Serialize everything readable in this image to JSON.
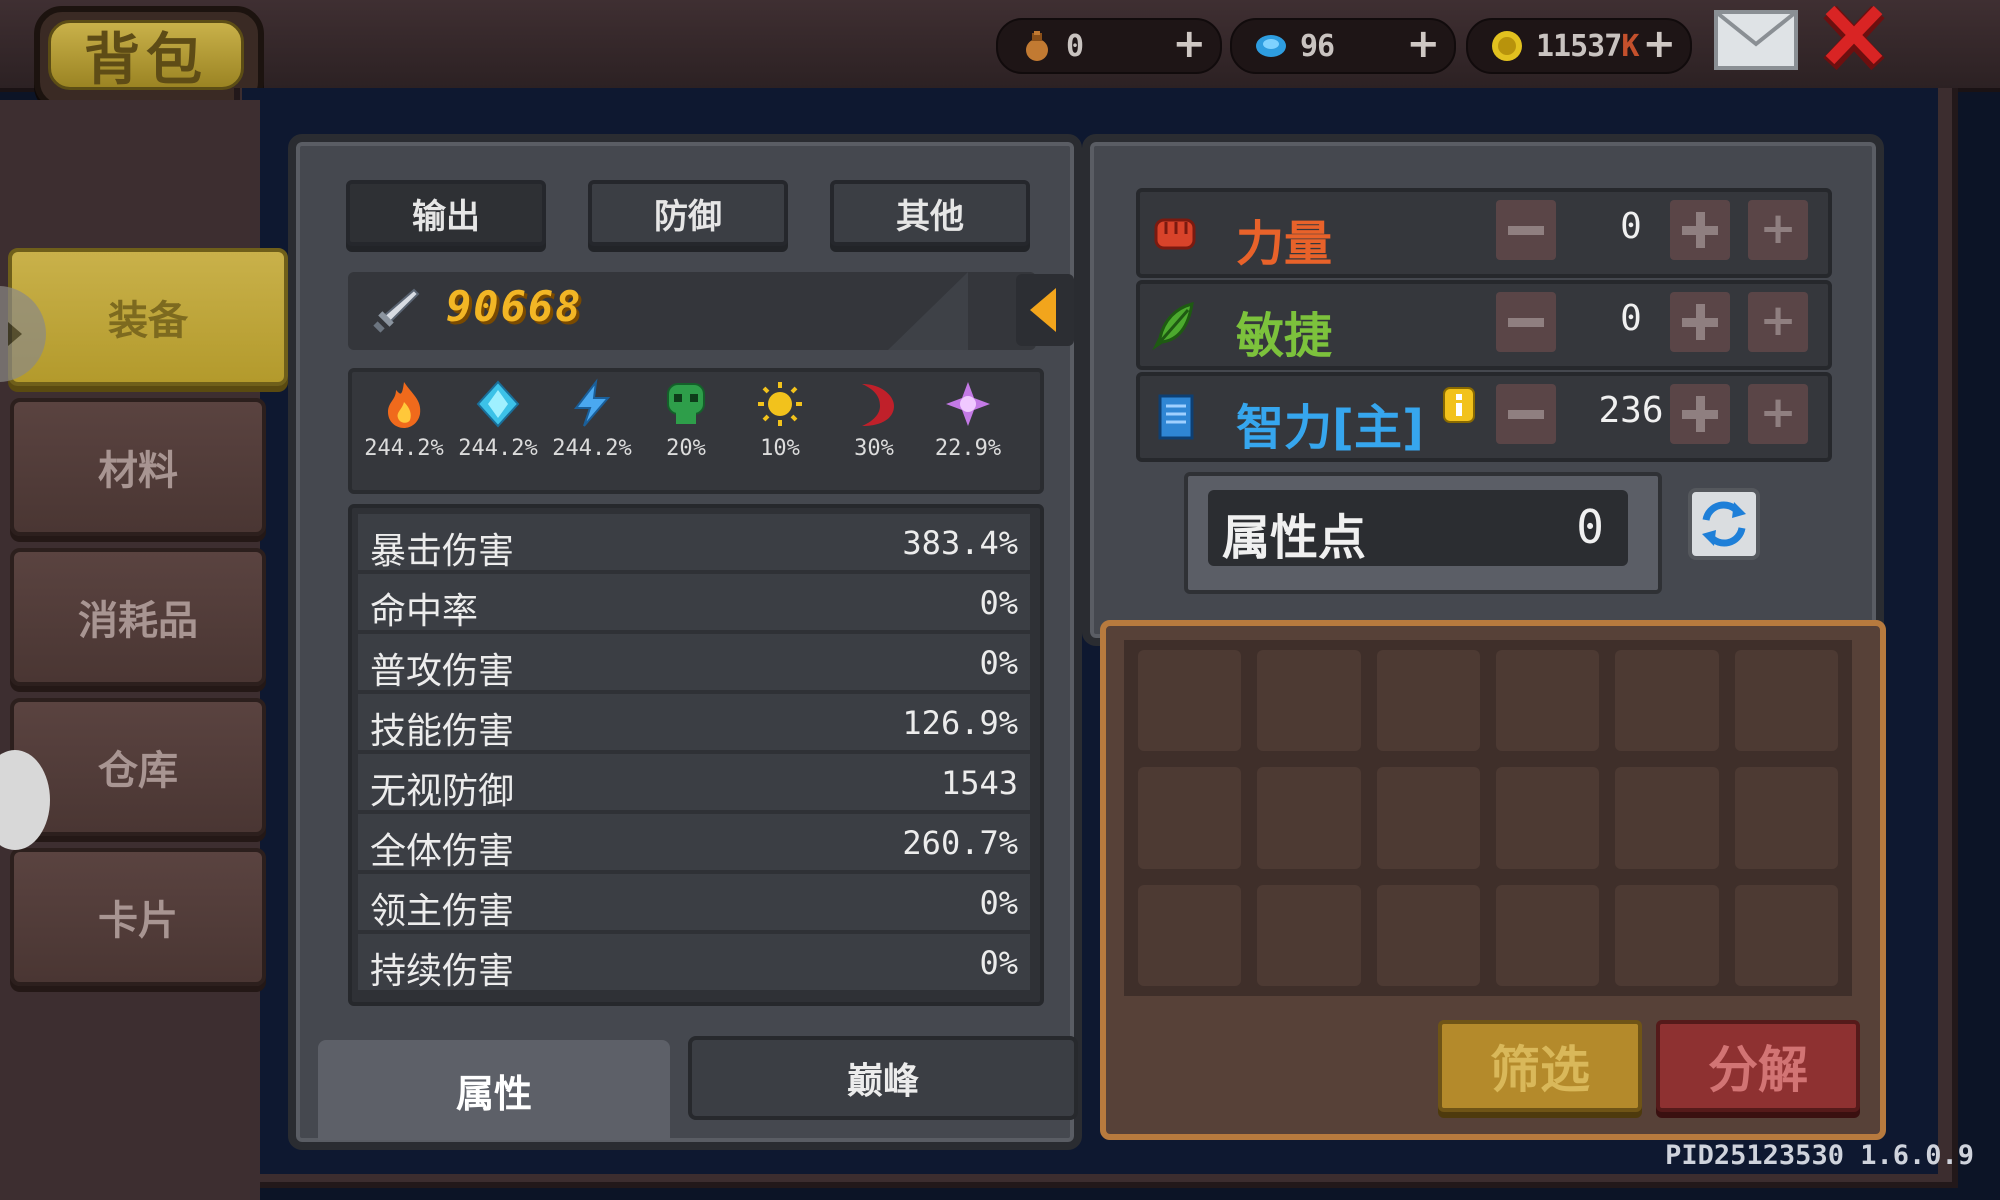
{
  "header": {
    "title": "背包",
    "currencies": [
      {
        "icon": "bag-icon",
        "value": "0",
        "suffix": "",
        "color": "#c27a32"
      },
      {
        "icon": "gem-icon",
        "value": "96",
        "suffix": "",
        "color": "#2e9de0"
      },
      {
        "icon": "gold-coin-icon",
        "value": "11537",
        "suffix": "K",
        "color": "#e2c11f"
      }
    ],
    "mail_icon": "envelope-icon",
    "close_icon": "close-x-icon"
  },
  "nav": {
    "items": [
      {
        "label": "装备",
        "active": true
      },
      {
        "label": "材料",
        "active": false
      },
      {
        "label": "消耗品",
        "active": false
      },
      {
        "label": "仓库",
        "active": false
      },
      {
        "label": "卡片",
        "active": false
      }
    ]
  },
  "stats": {
    "tabs": [
      "输出",
      "防御",
      "其他"
    ],
    "active_tab": "输出",
    "power_icon": "sword-icon",
    "power": "90668",
    "elements": [
      {
        "icon": "fire-icon",
        "value": "244.2%",
        "color": "#f06a1c"
      },
      {
        "icon": "ice-crystal-icon",
        "value": "244.2%",
        "color": "#3cc2e8"
      },
      {
        "icon": "lightning-icon",
        "value": "244.2%",
        "color": "#4aa8f0"
      },
      {
        "icon": "poison-skull-icon",
        "value": "20%",
        "color": "#2e9e4a"
      },
      {
        "icon": "sun-icon",
        "value": "10%",
        "color": "#f2c21c"
      },
      {
        "icon": "crescent-moon-icon",
        "value": "30%",
        "color": "#c0202a"
      },
      {
        "icon": "arcane-star-icon",
        "value": "22.9%",
        "color": "#c47ae6"
      }
    ],
    "rows": [
      {
        "label": "暴击伤害",
        "value": "383.4%"
      },
      {
        "label": "命中率",
        "value": "0%"
      },
      {
        "label": "普攻伤害",
        "value": "0%"
      },
      {
        "label": "技能伤害",
        "value": "126.9%"
      },
      {
        "label": "无视防御",
        "value": "1543"
      },
      {
        "label": "全体伤害",
        "value": "260.7%"
      },
      {
        "label": "领主伤害",
        "value": "0%"
      },
      {
        "label": "持续伤害",
        "value": "0%"
      }
    ],
    "bottom_tabs": [
      "属性",
      "巅峰"
    ]
  },
  "attributes": {
    "rows": [
      {
        "icon": "fist-icon",
        "name": "力量",
        "value": "0",
        "color": "#e8622a"
      },
      {
        "icon": "feather-icon",
        "name": "敏捷",
        "value": "0",
        "color": "#7cc23c"
      },
      {
        "icon": "book-icon",
        "name": "智力[主]",
        "value": "236",
        "color": "#36a6ee"
      }
    ],
    "points_label": "属性点",
    "points_value": "0",
    "reset_icon": "refresh-icon"
  },
  "inventory": {
    "filter_label": "筛选",
    "decompose_label": "分解"
  },
  "version": "PID25123530 1.6.0.9"
}
